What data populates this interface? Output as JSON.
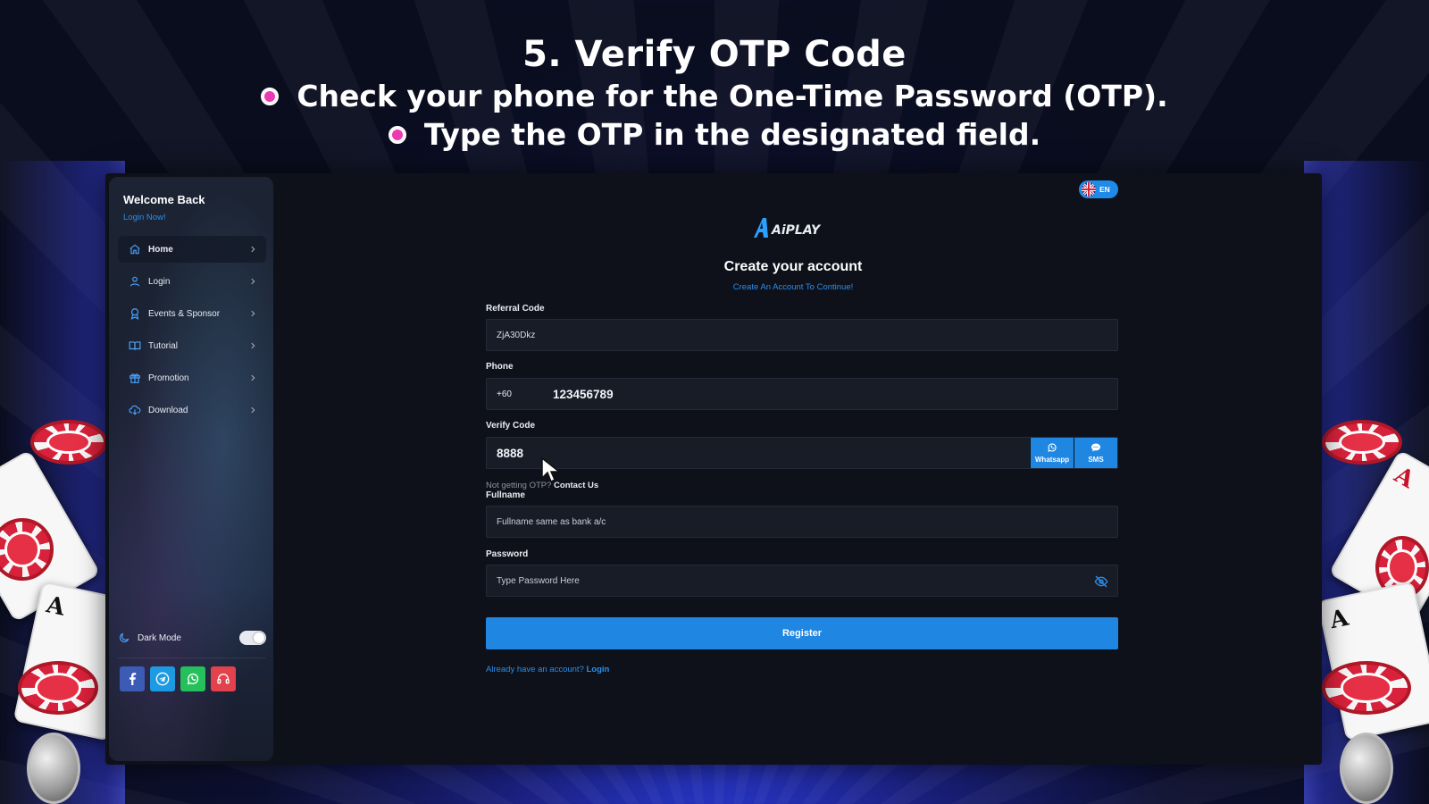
{
  "headline": {
    "title": "5. Verify OTP Code",
    "bullets": [
      "Check your phone for the One-Time Password (OTP).",
      "Type the OTP in the designated field."
    ]
  },
  "colors": {
    "accent": "#1f86e2",
    "link": "#2a8ff0",
    "bullet": "#e93ab3",
    "panel": "#0e1119"
  },
  "sidebar": {
    "welcome": "Welcome Back",
    "login_now": "Login Now!",
    "items": [
      {
        "label": "Home",
        "icon": "home-icon"
      },
      {
        "label": "Login",
        "icon": "user-icon"
      },
      {
        "label": "Events & Sponsor",
        "icon": "award-icon"
      },
      {
        "label": "Tutorial",
        "icon": "book-icon"
      },
      {
        "label": "Promotion",
        "icon": "gift-icon"
      },
      {
        "label": "Download",
        "icon": "cloud-download-icon"
      }
    ],
    "dark_mode_label": "Dark Mode",
    "dark_mode_on": true,
    "socials": [
      "facebook-icon",
      "telegram-icon",
      "whatsapp-icon",
      "headset-icon"
    ]
  },
  "language": {
    "code": "EN"
  },
  "logo_text": "AiPLAY",
  "form": {
    "title": "Create your account",
    "subtitle": "Create An Account To Continue!",
    "referral": {
      "label": "Referral Code",
      "value": "ZjA30Dkz"
    },
    "phone": {
      "label": "Phone",
      "prefix": "+60",
      "value": "123456789"
    },
    "verify": {
      "label": "Verify Code",
      "value": "8888",
      "whatsapp_label": "Whatsapp",
      "sms_label": "SMS",
      "help_prefix": "Not getting OTP?",
      "help_link": "Contact Us"
    },
    "fullname": {
      "label": "Fullname",
      "placeholder": "Fullname same as bank a/c"
    },
    "password": {
      "label": "Password",
      "placeholder": "Type Password Here"
    },
    "register_label": "Register",
    "already_text": "Already have an account?",
    "login_link": "Login"
  }
}
